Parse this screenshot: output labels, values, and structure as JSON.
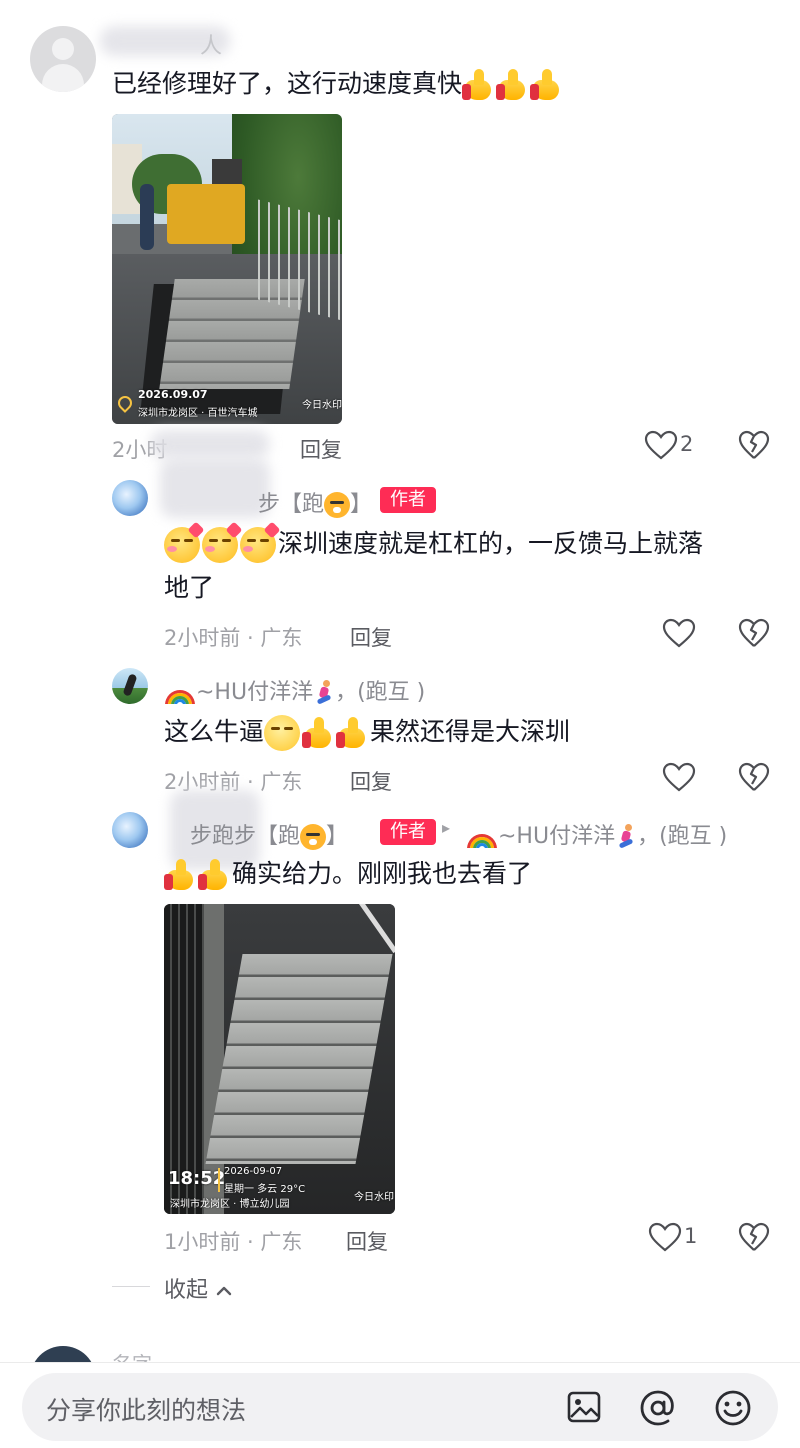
{
  "comment1": {
    "author": "人",
    "text": "已经修理好了，这行动速度真快",
    "photo": {
      "date": "2026.09.07",
      "location": "深圳市龙岗区 · 百世汽车城",
      "watermark": "今日水印"
    },
    "meta": "2小时",
    "reply_label": "回复",
    "like_count": "2"
  },
  "reply1": {
    "author_name": "步【跑",
    "author_name_end": "】",
    "badge": "作者",
    "text_line1": "深圳速度就是杠杠的，一反馈马上就落",
    "text_line2": "地了",
    "meta": "2小时前 · 广东",
    "reply_label": "回复"
  },
  "reply2": {
    "author_name": "~HU付洋洋",
    "author_suffix": "，(跑互 )",
    "text_start": "这么牛逼",
    "text_end": "果然还得是大深圳",
    "meta": "2小时前 · 广东",
    "reply_label": "回复"
  },
  "reply3": {
    "author_name": "步跑步【跑",
    "author_name_end": "】",
    "badge": "作者",
    "arrow": "▸",
    "reply_to_name": "~HU付洋洋",
    "reply_to_suffix": "，(跑互 )",
    "text": "确实给力。刚刚我也去看了",
    "photo": {
      "time": "18:52",
      "date": "2026-09-07",
      "weekday_weather": "星期一   多云 29°C",
      "location": "深圳市龙岗区 · 博立幼儿园",
      "watermark": "今日水印"
    },
    "meta": "1小时前 · 广东",
    "reply_label": "回复",
    "like_count": "1"
  },
  "collapse_label": "收起",
  "next_comment_name": "名字",
  "input": {
    "placeholder": "分享你此刻的想法"
  },
  "icons": [
    "avatar-icon",
    "thumbs-up-icon",
    "wink-emoji-icon",
    "tiger-emoji-icon",
    "rainbow-emoji-icon",
    "runner-emoji-icon",
    "heart-outline-icon",
    "broken-heart-icon",
    "image-icon",
    "at-icon",
    "emoji-icon",
    "chevron-up-icon"
  ],
  "colors": {
    "badge": "#fe2c55",
    "text": "#161823",
    "meta": "#a0a1a6"
  }
}
